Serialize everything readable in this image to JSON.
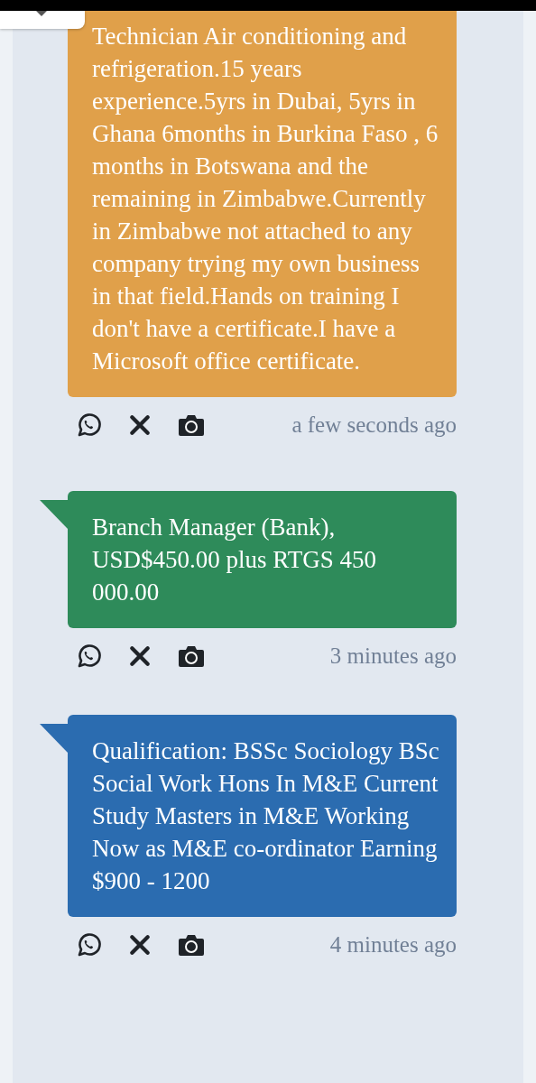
{
  "messages": [
    {
      "text": "Technician Air conditioning and refrigeration.15 years experience.5yrs in Dubai, 5yrs in Ghana 6months in Burkina Faso , 6 months in Botswana and the remaining in Zimbabwe.Currently in Zimbabwe not attached to any company trying my own business in that field.Hands on training I don't have a certificate.I have a Microsoft office certificate.",
      "color": "#e0a04a",
      "tail": false,
      "time": "a few seconds ago"
    },
    {
      "text": "Branch Manager (Bank), USD$450.00 plus RTGS 450 000.00",
      "color": "#2e8b5a",
      "tail": true,
      "time": "3 minutes ago"
    },
    {
      "text": "Qualification: BSSc Sociology BSc Social Work Hons In M&E Current Study Masters in M&E Working Now as M&E co-ordinator Earning $900 - 1200",
      "color": "#2b6cb0",
      "tail": true,
      "time": "4 minutes ago"
    }
  ]
}
